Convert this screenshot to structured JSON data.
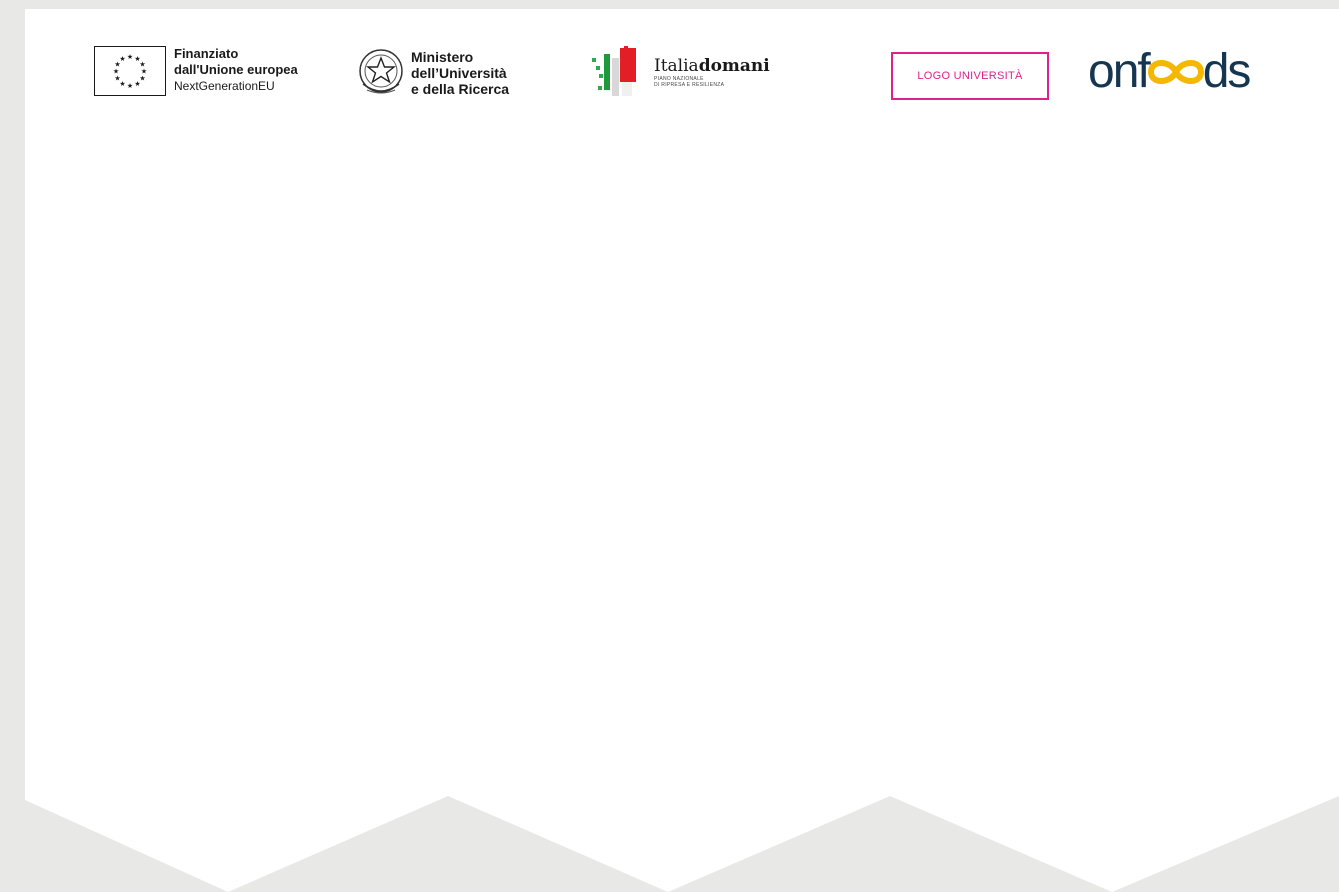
{
  "header": {
    "eu": {
      "line1": "Finanziato",
      "line2": "dall'Unione europea",
      "line3": "NextGenerationEU",
      "icon": "eu-flag-icon"
    },
    "mur": {
      "line1": "Ministero",
      "line2": "dell’Università",
      "line3": "e della Ricerca",
      "icon": "italian-republic-emblem-icon"
    },
    "italiadomani": {
      "title_plain": "Italia",
      "title_bold": "domani",
      "sub1": "PIANO NAZIONALE",
      "sub2": "DI RIPRESA E RESILIENZA",
      "icon": "italiadomani-flag-icon"
    },
    "university_placeholder": "LOGO UNIVERSITÀ",
    "onfoods": {
      "prefix": "onf",
      "suffix": "ds",
      "icon": "infinity-oo-icon"
    }
  },
  "colors": {
    "background": "#e8e9e7",
    "page": "#ffffff",
    "accent_pink": "#e0218a",
    "onfoods_navy": "#143650",
    "onfoods_yellow": "#f5b800"
  }
}
